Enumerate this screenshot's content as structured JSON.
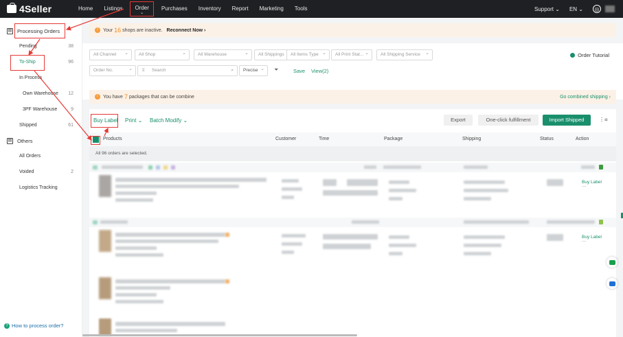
{
  "app": {
    "name": "4Seller"
  },
  "nav": {
    "items": [
      "Home",
      "Listings",
      "Order",
      "Purchases",
      "Inventory",
      "Report",
      "Marketing",
      "Tools"
    ],
    "active": "Order",
    "support": "Support",
    "lang": "EN"
  },
  "sidebar": {
    "processing": "Processing Orders",
    "pending": {
      "label": "Pending",
      "count": "38"
    },
    "toship": {
      "label": "To-Ship",
      "count": "96"
    },
    "inprocess": {
      "label": "In Process"
    },
    "own": {
      "label": "Own Warehouse",
      "count": "12"
    },
    "tpf": {
      "label": "3PF Warehouse",
      "count": "9"
    },
    "shipped": {
      "label": "Shipped",
      "count": "61"
    },
    "others": "Others",
    "allorders": {
      "label": "All Orders"
    },
    "voided": {
      "label": "Voided",
      "count": "2"
    },
    "logistics": {
      "label": "Logistics Tracking"
    },
    "help": "How to process order?"
  },
  "banner1": {
    "pre": "Your",
    "num": "16",
    "post": "shops are inactive.",
    "link": "Reconnect Now ›"
  },
  "filters": {
    "row1": [
      "All Channel",
      "All Shop",
      "All Warehouse",
      "All Shippings",
      "All Items Type",
      "All Print Stat...",
      "All Shipping Service"
    ],
    "order_field": "Order No.",
    "search_placeholder": "Search",
    "precise": "Precise",
    "save": "Save",
    "view": "View(2)",
    "tutorial": "Order Tutorial"
  },
  "banner2": {
    "pre": "You have",
    "num": "7",
    "post": "packages that can be combine",
    "link": "Go combined shipping ›"
  },
  "toolbar": {
    "buy_label": "Buy Label",
    "print": "Print",
    "batch_modify": "Batch Modify",
    "export": "Export",
    "fulfill": "One-click fulfillment",
    "import": "Import Shipped"
  },
  "table": {
    "headers": [
      "Products",
      "Customer",
      "Time",
      "Package",
      "Shipping",
      "Status",
      "Action"
    ],
    "selected_text": "All 96 orders are selected.",
    "rows": [
      {
        "action": "Buy Label",
        "more": "···"
      },
      {
        "action": "Buy Label",
        "more": "···"
      }
    ]
  }
}
